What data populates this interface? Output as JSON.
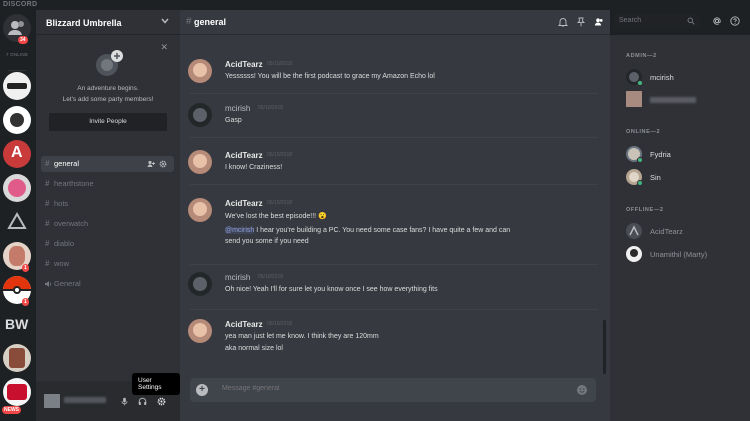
{
  "titlebar": {
    "brand": "DISCORD",
    "window_controls": [
      "—",
      "▢",
      "✕"
    ]
  },
  "guilds": {
    "online_label": "7 ONLINE",
    "home_badge": "34",
    "badges": [
      "1",
      "1"
    ],
    "news_label": "NEWS"
  },
  "server": {
    "name": "Blizzard Umbrella"
  },
  "invite": {
    "line1": "An adventure begins.",
    "line2": "Let's add some party members!",
    "button": "Invite People"
  },
  "channels": [
    {
      "name": "general",
      "active": true
    },
    {
      "name": "hearthstone",
      "active": false
    },
    {
      "name": "hots",
      "active": false
    },
    {
      "name": "overwatch",
      "active": false
    },
    {
      "name": "diablo",
      "active": false
    },
    {
      "name": "wow",
      "active": false
    }
  ],
  "voice_channel": {
    "name": "General"
  },
  "tooltip": "User Settings",
  "chat": {
    "channel": "general",
    "input_placeholder": "Message #general",
    "messages": [
      {
        "author": "AcidTearz",
        "color": "#e8e8e8",
        "time": "05/10/2018",
        "lines": [
          "Yessssss! You will be the first podcast to grace my Amazon Echo lol"
        ]
      },
      {
        "author": "mcirish",
        "color": "#b9bbbe",
        "time": "05/10/2018",
        "lines": [
          "Gasp"
        ]
      },
      {
        "author": "AcidTearz",
        "color": "#e8e8e8",
        "time": "05/10/2018",
        "lines": [
          "I know! Craziness!"
        ]
      },
      {
        "author": "AcidTearz",
        "color": "#e8e8e8",
        "time": "05/10/2018",
        "lines": [
          "We've lost the best episode!!! 😮"
        ],
        "mention_line": {
          "mention": "@mcirish",
          "text": " I hear you're building a PC. You need some case fans? I have quite a few and can"
        },
        "extra_line": "send you some if you need"
      },
      {
        "author": "mcirish",
        "color": "#b9bbbe",
        "time": "05/10/2018",
        "lines": [
          "Oh nice!  Yeah I'll for sure let you know once I see how everything fits"
        ]
      },
      {
        "author": "AcidTearz",
        "color": "#e8e8e8",
        "time": "05/10/2018",
        "lines": [
          "yea man just let me know. I think they are 120mm",
          "aka normal size lol"
        ]
      }
    ]
  },
  "search": {
    "placeholder": "Search"
  },
  "members": {
    "groups": [
      {
        "label": "ADMIN—2",
        "members": [
          {
            "name": "mcirish",
            "status": "#43b581",
            "color": "#dcddde"
          },
          {
            "name": "",
            "status": "",
            "color": "#dcddde"
          }
        ]
      },
      {
        "label": "ONLINE—2",
        "members": [
          {
            "name": "Fydria",
            "status": "#43b581",
            "color": "#dcddde"
          },
          {
            "name": "Sin",
            "status": "#43b581",
            "color": "#dcddde"
          }
        ]
      },
      {
        "label": "OFFLINE—2",
        "members": [
          {
            "name": "AcidTearz",
            "status": "",
            "color": "#8e9297"
          },
          {
            "name": "Unamithil (Marty)",
            "status": "",
            "color": "#8e9297"
          }
        ]
      }
    ]
  },
  "colors": {
    "accent": "#7289da",
    "online": "#43b581",
    "alert": "#f04747"
  }
}
